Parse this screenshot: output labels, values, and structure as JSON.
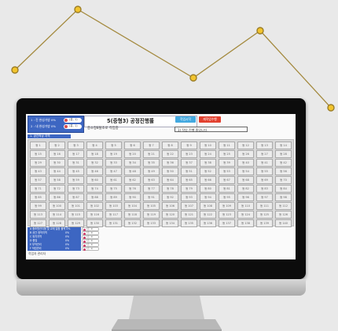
{
  "colors": {
    "background": "#e9e9e9",
    "line": "#a48a3f",
    "marker": "#f2c42e",
    "panel_blue": "#3d66c2",
    "percent_red": "#e02020",
    "button_blue": "#43a9e0",
    "button_red": "#e2402e"
  },
  "header": {
    "status_rows": [
      {
        "label": "1 : 진 완성가방 0%",
        "badge": "(흥, 1)"
      },
      {
        "label": "2 : 내 완성가방 0%",
        "badge": "(흥, 1)"
      }
    ],
    "title": "5(중형3) 공정진행률",
    "percent": "0%",
    "button_blue": "작업시작",
    "button_red": "재작업수행",
    "sub_label": "중소형8탈조로 작업중",
    "message": "1) 작업 진행 중입니다."
  },
  "section_label": "1. 공간적상 지역",
  "cells": [
    "동 1",
    "동 2",
    "동 3",
    "동 4",
    "동 5",
    "동 6",
    "동 7",
    "동 8",
    "동 9",
    "동 10",
    "동 11",
    "동 12",
    "동 13",
    "동 14",
    "동 15",
    "동 16",
    "동 17",
    "동 18",
    "동 19",
    "동 20",
    "동 21",
    "동 22",
    "동 23",
    "동 24",
    "동 25",
    "동 26",
    "동 27",
    "동 28",
    "동 29",
    "동 30",
    "동 31",
    "동 32",
    "동 33",
    "동 34",
    "동 35",
    "동 36",
    "동 37",
    "동 38",
    "동 39",
    "동 40",
    "동 41",
    "동 42",
    "동 43",
    "동 44",
    "동 45",
    "동 46",
    "동 47",
    "동 48",
    "동 49",
    "동 50",
    "동 51",
    "동 52",
    "동 53",
    "동 54",
    "동 55",
    "동 56",
    "동 57",
    "동 58",
    "동 59",
    "동 60",
    "동 61",
    "동 62",
    "동 63",
    "동 64",
    "동 65",
    "동 66",
    "동 67",
    "동 68",
    "동 69",
    "동 70",
    "동 71",
    "동 72",
    "동 73",
    "동 74",
    "동 75",
    "동 76",
    "동 77",
    "동 78",
    "동 79",
    "동 80",
    "동 81",
    "동 82",
    "동 83",
    "동 84",
    "동 85",
    "동 86",
    "동 87",
    "동 88",
    "동 89",
    "동 90",
    "동 91",
    "동 92",
    "동 93",
    "동 94",
    "동 95",
    "동 96",
    "동 97",
    "동 98",
    "동 99",
    "동 100",
    "동 101",
    "동 102",
    "동 103",
    "동 104",
    "동 105",
    "동 106",
    "동 107",
    "동 108",
    "동 109",
    "동 110",
    "동 111",
    "동 112",
    "동 113",
    "동 114",
    "동 115",
    "동 116",
    "동 117",
    "동 118",
    "동 119",
    "동 120",
    "동 121",
    "동 122",
    "동 123",
    "동 124",
    "동 125",
    "동 126",
    "동 127",
    "동 128",
    "동 129",
    "동 130",
    "동 131",
    "동 132",
    "동 133",
    "동 134",
    "동 135",
    "동 136",
    "동 137",
    "동 138",
    "동 139",
    "동 140"
  ],
  "bottom_rows": [
    {
      "key": "A 중조원관지형 및 교재 일정 물적 0%",
      "value": "",
      "badge": "(흥, 1)"
    },
    {
      "key": "B 공간 정착지역",
      "value": "0%",
      "badge": "(흥, 1)"
    },
    {
      "key": "C 위치지역",
      "value": "0%",
      "badge": "(흥, 1)"
    },
    {
      "key": "D 품질",
      "value": "0%",
      "badge": "(흥, 1)"
    },
    {
      "key": "E 부착관리",
      "value": "0%",
      "badge": "(흥, 1)"
    },
    {
      "key": "F 작업관리",
      "value": "0%",
      "badge": "(흥, 1)"
    }
  ],
  "footer_label": "작업자 관리자"
}
